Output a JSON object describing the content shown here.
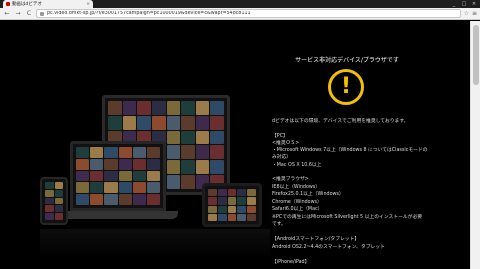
{
  "browser": {
    "tab_title": "動画はdビデオ",
    "tab_close": "×",
    "win_min": "_",
    "win_max": "□",
    "win_close": "×",
    "back": "←",
    "forward": "→",
    "reload": "C",
    "url": "pc.video.dmkt-sp.jp/?f/e3001757campaign=pc1000019&device=c&wapr=548c8111",
    "star": "☆",
    "menu": "≡"
  },
  "page": {
    "title": "サービス非対応デバイス/ブラウザです",
    "warning_mark": "!",
    "intro": "dビデオは以下の環境、デバイスでご利用を推奨しております。",
    "pc_heading": "【PC】",
    "os_heading": "<推奨ＯＳ>",
    "os_items": [
      "・Microsoft Windows 7以上（Windows 8 についてはClassicモードの",
      "み対応）",
      "・Mac OS X 10.6以上"
    ],
    "browser_heading": "<推奨ブラウザ>",
    "browser_items": [
      "IE8以上（Windows）",
      "Firefox25.0.1以上（Windows）",
      "Chrome（Windows）",
      "Safari6.0以上（Mac）"
    ],
    "silverlight_note": [
      "※PCでの再生にはMicrosoft Silverlight 5 以上のインストールが必要",
      "です。"
    ],
    "android_heading": "【Androidスマートフォン/タブレット】",
    "android_item": "Android OS2.2~4.4のスマートフォン、タブレット",
    "iphone_heading": "【iPhone/iPad】"
  },
  "colors": {
    "accent_warning": "#f3c000",
    "background": "#000000"
  }
}
